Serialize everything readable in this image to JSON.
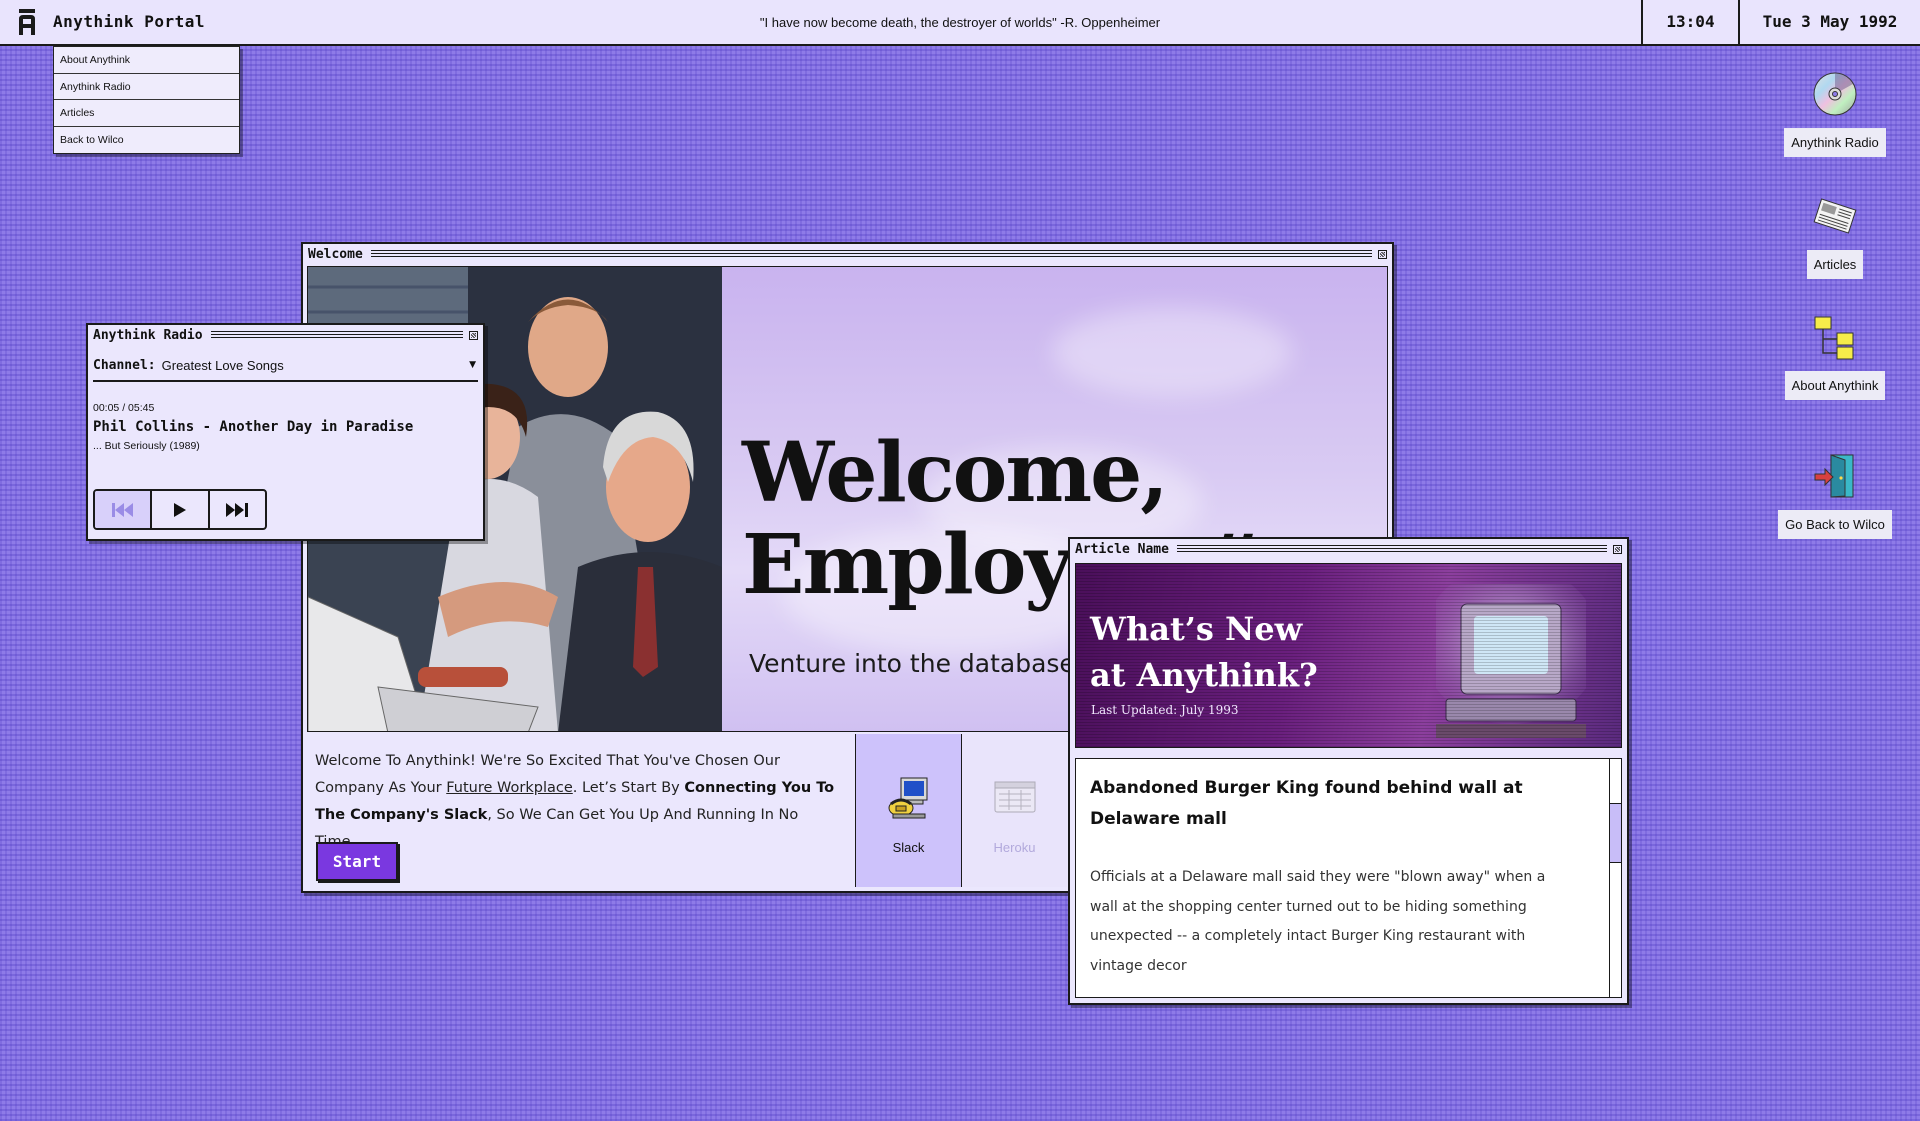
{
  "menubar": {
    "app_title": "Anythink Portal",
    "quote": "\"I have now become death, the destroyer of worlds\"    -R. Oppenheimer",
    "time": "13:04",
    "date": "Tue 3 May 1992"
  },
  "dropdown": {
    "items": [
      {
        "label": "About Anythink"
      },
      {
        "label": "Anythink Radio"
      },
      {
        "label": "Articles"
      },
      {
        "label": "Back to Wilco"
      }
    ]
  },
  "desktop_icons": [
    {
      "label": "Anythink Radio",
      "icon": "cd-disc-icon"
    },
    {
      "label": "Articles",
      "icon": "newspaper-icon"
    },
    {
      "label": "About Anythink",
      "icon": "folder-tree-icon"
    },
    {
      "label": "Go Back to Wilco",
      "icon": "exit-door-icon"
    }
  ],
  "welcome": {
    "window_title": "Welcome",
    "hero_title_line1": "Welcome,",
    "hero_title_line2": "Employee #",
    "hero_subtitle": "Venture into the database.",
    "intro_part1": "Welcome To Anythink! We're So Excited That You've Chosen Our Company As Your ",
    "intro_link": "Future Workplace",
    "intro_part2": ". Let’s Start By ",
    "intro_bold": "Connecting You To The Company's Slack",
    "intro_part3": ", So We Can Get You Up And Running In No Time.",
    "start_label": "Start",
    "tools": [
      {
        "label": "Slack",
        "icon": "computer-phone-icon",
        "active": true
      },
      {
        "label": "Heroku",
        "icon": "spreadsheet-icon",
        "active": false
      }
    ]
  },
  "radio": {
    "window_title": "Anythink Radio",
    "channel_key": "Channel:",
    "channel_value": "Greatest Love Songs",
    "time": "00:05 / 05:45",
    "song": "Phil Collins - Another Day in Paradise",
    "album": "... But Seriously (1989)",
    "controls": [
      "previous",
      "play",
      "next"
    ]
  },
  "article": {
    "window_title": "Article Name",
    "banner_title_line1": "What’s New",
    "banner_title_line2": "at Anythink?",
    "banner_subtitle": "Last Updated: July 1993",
    "headline": "Abandoned Burger King found behind wall at Delaware mall",
    "summary": "Officials at a Delaware mall said they were \"blown away\" when a wall at the shopping center turned out to be hiding something unexpected -- a completely intact Burger King restaurant with vintage decor"
  },
  "colors": {
    "desktop": "#8e7be8",
    "window_bg": "#ebe7fd",
    "accent": "#7a38e0",
    "tool_active": "#cdc2fb"
  }
}
